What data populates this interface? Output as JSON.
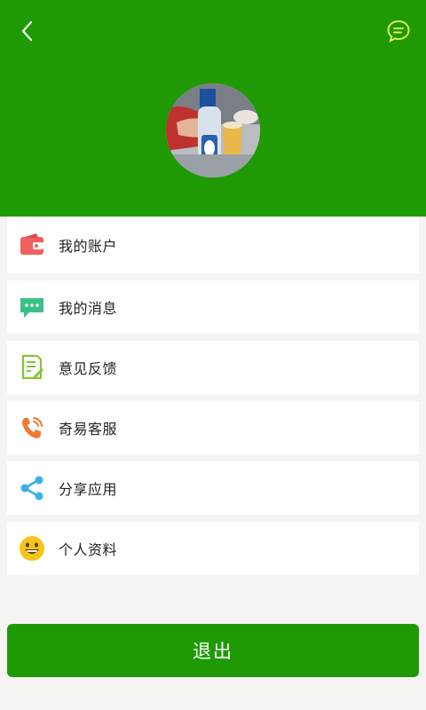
{
  "header": {
    "back_icon": "chevron-left-icon",
    "message_icon": "chat-bubble-icon",
    "background_color": "#1f9a05"
  },
  "menu": {
    "items": [
      {
        "label": "我的账户",
        "icon": "wallet-icon",
        "color": "#f0605e"
      },
      {
        "label": "我的消息",
        "icon": "message-icon",
        "color": "#3cbf85"
      },
      {
        "label": "意见反馈",
        "icon": "feedback-icon",
        "color": "#86c43a"
      },
      {
        "label": "奇易客服",
        "icon": "phone-icon",
        "color": "#f07a30"
      },
      {
        "label": "分享应用",
        "icon": "share-icon",
        "color": "#38b0e8"
      },
      {
        "label": "个人资料",
        "icon": "smiley-icon",
        "color": "#f5c518"
      }
    ]
  },
  "logout": {
    "label": "退出",
    "color": "#1f9a05"
  }
}
